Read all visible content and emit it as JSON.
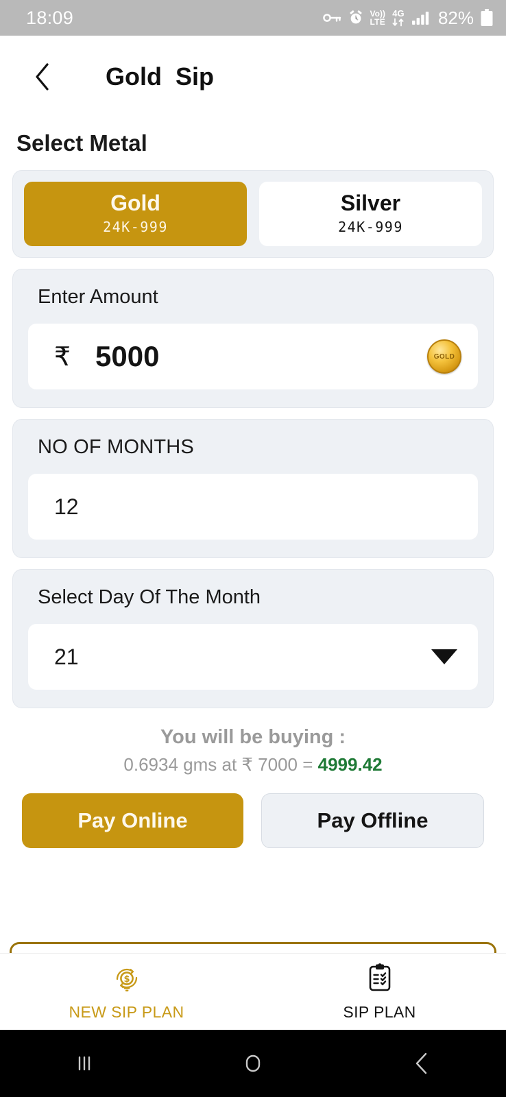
{
  "status_bar": {
    "time": "18:09",
    "battery_percent": "82%",
    "icons": [
      "key-icon",
      "alarm-icon",
      "volte-icon",
      "4g-data-icon",
      "signal-bars-icon",
      "battery-icon"
    ],
    "volte_top": "Vo))",
    "volte_bottom": "LTE",
    "network_type": "4G",
    "background": "#b9b9b9"
  },
  "header": {
    "back_icon": "chevron-left-icon",
    "title": "Gold  Sip"
  },
  "main": {
    "section_title": "Select Metal",
    "metals": [
      {
        "name": "Gold",
        "purity": "24K-999",
        "selected": true
      },
      {
        "name": "Silver",
        "purity": "24K-999",
        "selected": false
      }
    ],
    "amount": {
      "label": "Enter Amount",
      "currency_symbol": "₹",
      "value": "5000",
      "coin_icon_text": "GOLD"
    },
    "months": {
      "label": "NO OF MONTHS",
      "value": "12"
    },
    "day": {
      "label": "Select Day Of The Month",
      "value": "21",
      "dropdown_icon": "caret-down-icon"
    },
    "summary": {
      "heading": "You will be buying :",
      "detail_prefix": "0.6934 gms at ₹ 7000 = ",
      "total": "4999.42",
      "grams": "0.6934",
      "rate": "7000",
      "total_color": "#1f7a36"
    },
    "actions": {
      "pay_online": "Pay Online",
      "pay_offline": "Pay Offline"
    }
  },
  "tab_bar": {
    "tabs": [
      {
        "label": "NEW SIP PLAN",
        "icon": "coin-refresh-icon",
        "active": true
      },
      {
        "label": "SIP PLAN",
        "icon": "clipboard-check-icon",
        "active": false
      }
    ],
    "accent": "#c89a18"
  },
  "android_nav": {
    "buttons": [
      "recents-icon",
      "home-icon",
      "back-icon"
    ]
  },
  "theme": {
    "gold": "#c69510",
    "card_bg": "#eef1f5",
    "green": "#1f7a36"
  }
}
